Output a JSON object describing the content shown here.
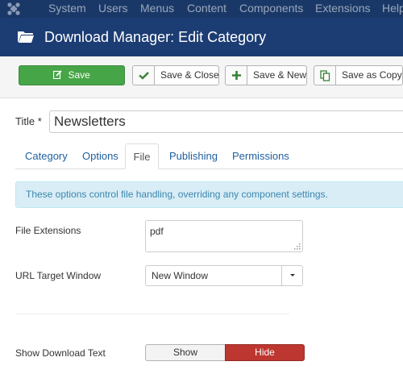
{
  "topnav": {
    "logo_icon": "joomla-icon",
    "items": [
      "System",
      "Users",
      "Menus",
      "Content",
      "Components",
      "Extensions",
      "Help"
    ]
  },
  "header": {
    "icon": "folder-icon",
    "title": "Download Manager: Edit Category"
  },
  "toolbar": {
    "save": {
      "label": "Save",
      "icon": "edit-icon"
    },
    "save_close": {
      "label": "Save & Close",
      "icon": "checkmark-icon"
    },
    "save_new": {
      "label": "Save & New",
      "icon": "plus-icon"
    },
    "save_copy": {
      "label": "Save as Copy",
      "icon": "copy-icon"
    }
  },
  "form": {
    "title_label": "Title *",
    "title_value": "Newsletters"
  },
  "tabs": [
    {
      "label": "Category",
      "active": false
    },
    {
      "label": "Options",
      "active": false
    },
    {
      "label": "File",
      "active": true
    },
    {
      "label": "Publishing",
      "active": false
    },
    {
      "label": "Permissions",
      "active": false
    }
  ],
  "file_tab": {
    "info": "These options control file handling, overriding any component settings.",
    "extensions_label": "File Extensions",
    "extensions_value": "pdf",
    "target_label": "URL Target Window",
    "target_value": "New Window",
    "download_text_label": "Show Download Text",
    "show_label": "Show",
    "hide_label": "Hide",
    "download_text_selected": "Hide"
  },
  "colors": {
    "nav_bg": "#1a3867",
    "header_bg": "#1c3d73",
    "save_green": "#46a546",
    "hide_red": "#bd362f",
    "link_blue": "#1f5e9e",
    "info_bg": "#d9edf7"
  }
}
